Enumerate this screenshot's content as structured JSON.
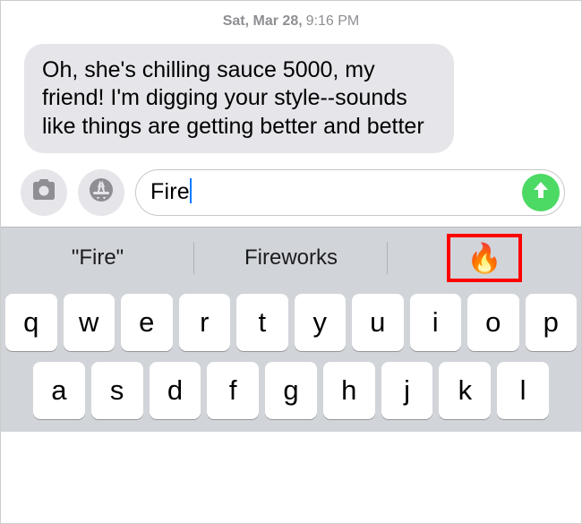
{
  "timestamp": {
    "date": "Sat, Mar 28,",
    "time": "9:16 PM"
  },
  "message": "Oh, she's chilling sauce 5000, my friend!  I'm digging your style--sounds like things are getting better and better",
  "input": {
    "value": "Fire"
  },
  "suggestions": {
    "s1": "\"Fire\"",
    "s2": "Fireworks",
    "s3": "🔥"
  },
  "keyboard": {
    "row1": {
      "k0": "q",
      "k1": "w",
      "k2": "e",
      "k3": "r",
      "k4": "t",
      "k5": "y",
      "k6": "u",
      "k7": "i",
      "k8": "o",
      "k9": "p"
    },
    "row2": {
      "k0": "a",
      "k1": "s",
      "k2": "d",
      "k3": "f",
      "k4": "g",
      "k5": "h",
      "k6": "j",
      "k7": "k",
      "k8": "l"
    }
  }
}
